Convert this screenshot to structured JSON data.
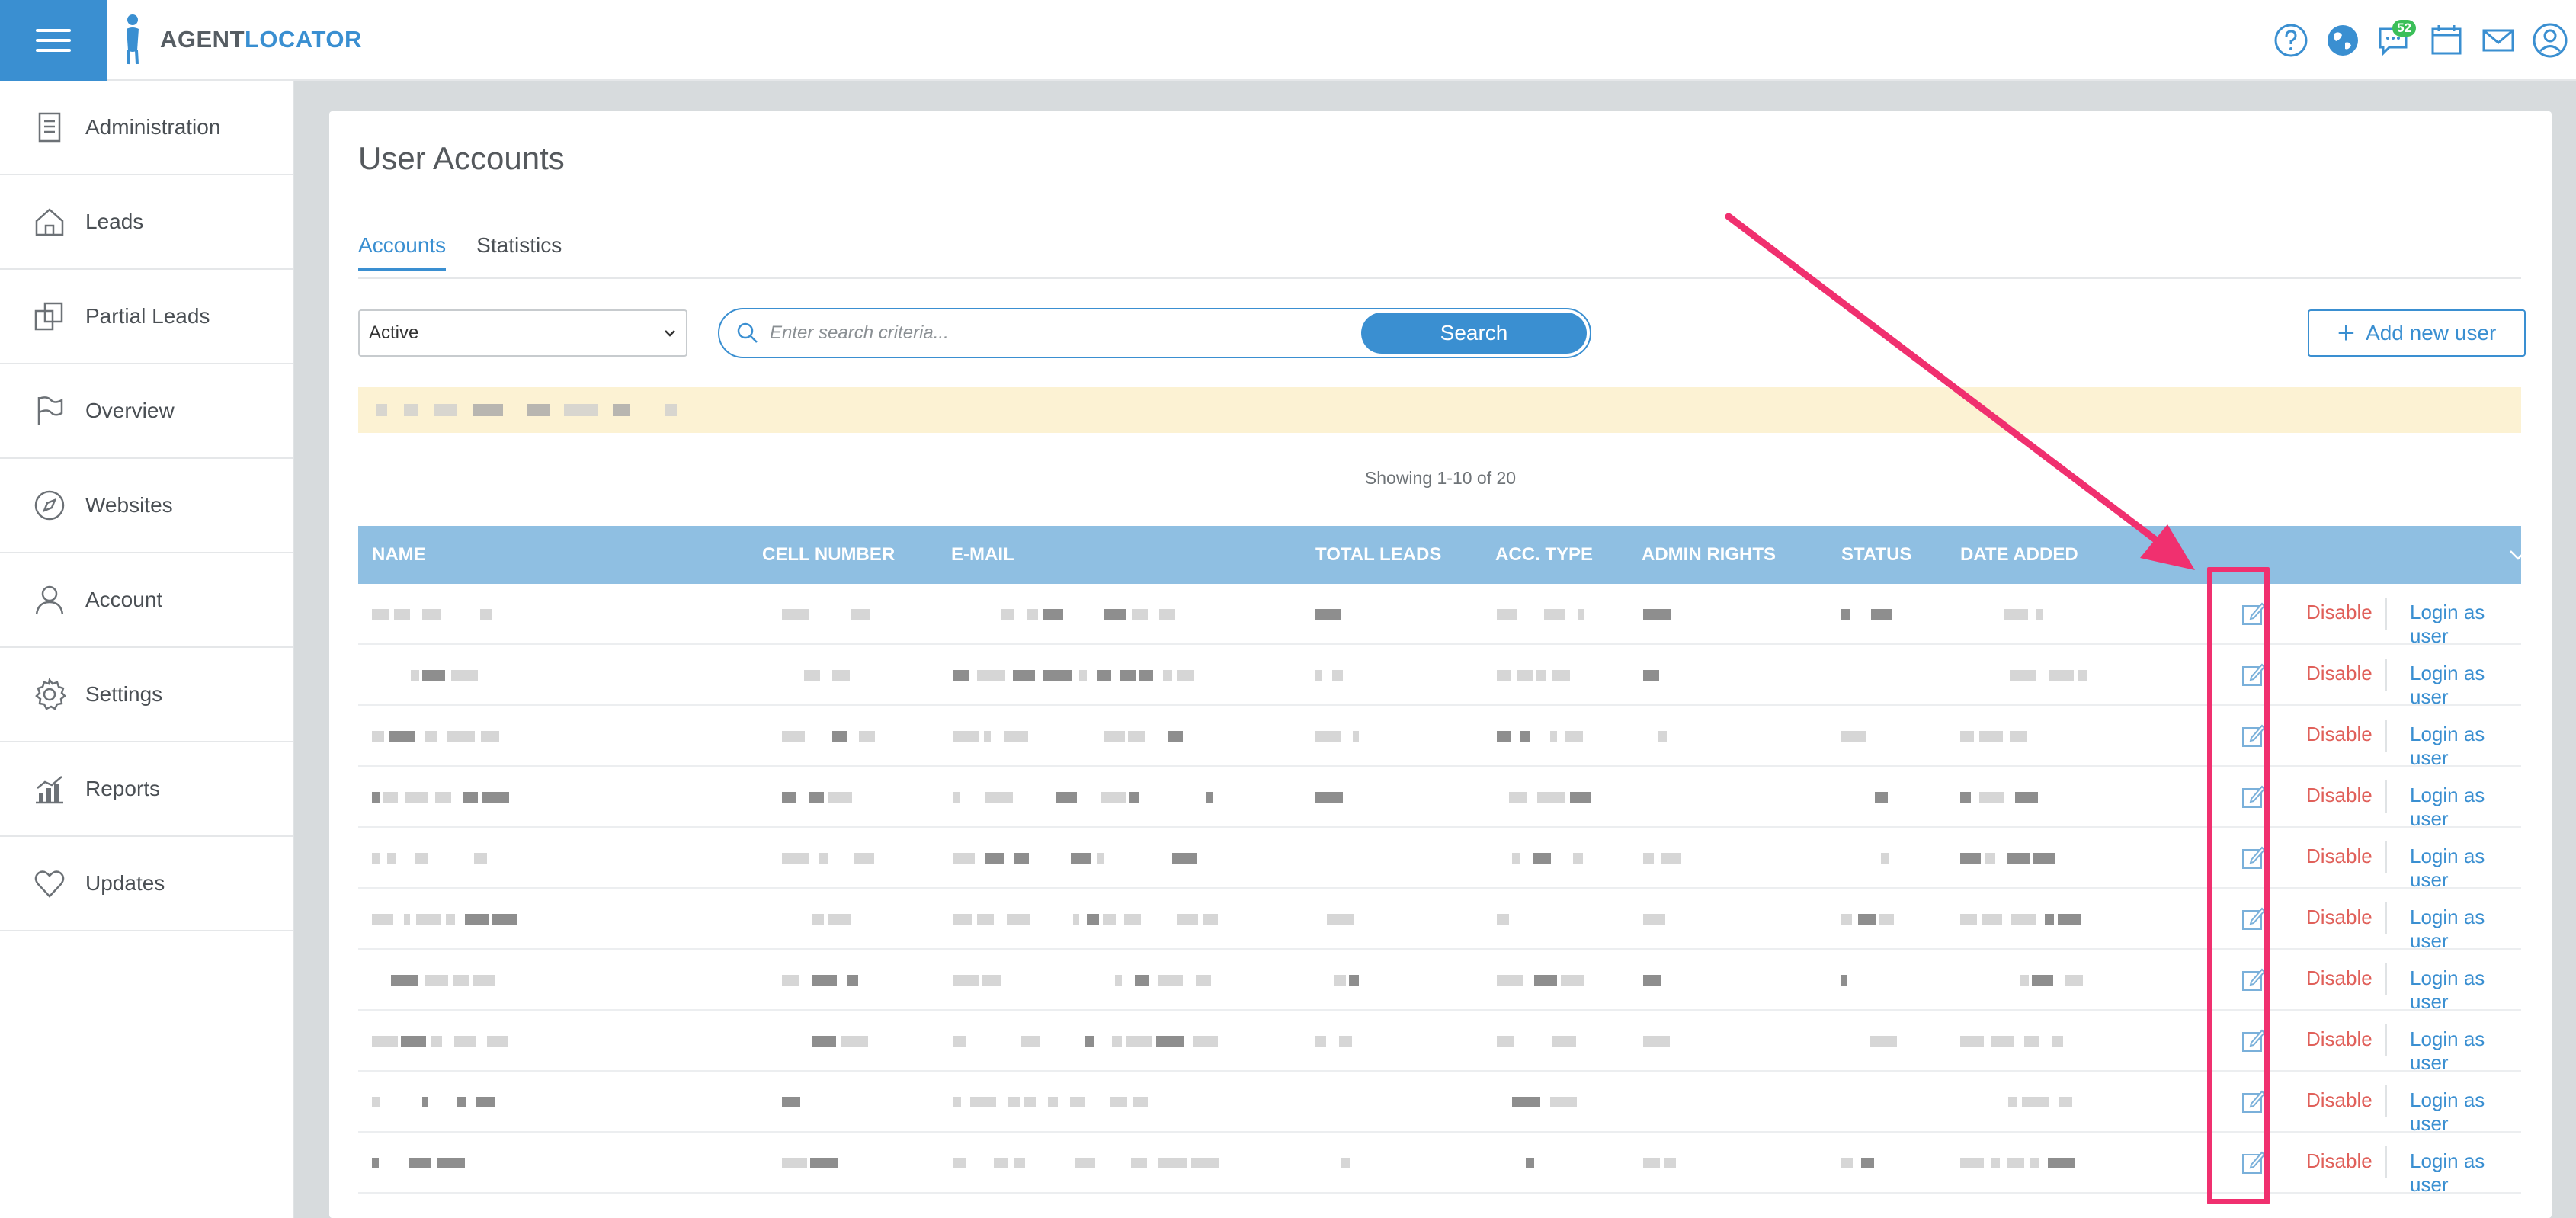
{
  "header": {
    "logo_part1": "AGENT",
    "logo_part2": "LOCATOR",
    "messages_badge": "52",
    "icons": [
      "help-icon",
      "globe-icon",
      "chat-icon",
      "calendar-icon",
      "mail-icon",
      "user-icon"
    ]
  },
  "sidebar": {
    "items": [
      {
        "label": "Administration",
        "icon": "document-icon"
      },
      {
        "label": "Leads",
        "icon": "home-icon"
      },
      {
        "label": "Partial Leads",
        "icon": "copy-icon"
      },
      {
        "label": "Overview",
        "icon": "flag-icon"
      },
      {
        "label": "Websites",
        "icon": "compass-icon"
      },
      {
        "label": "Account",
        "icon": "person-icon"
      },
      {
        "label": "Settings",
        "icon": "gear-icon"
      },
      {
        "label": "Reports",
        "icon": "chart-icon"
      },
      {
        "label": "Updates",
        "icon": "heart-icon"
      }
    ]
  },
  "main": {
    "title": "User Accounts",
    "tabs": [
      {
        "label": "Accounts",
        "active": true
      },
      {
        "label": "Statistics",
        "active": false
      }
    ],
    "status_filter": {
      "selected": "Active"
    },
    "search": {
      "placeholder": "Enter search criteria...",
      "button_label": "Search"
    },
    "add_user_label": "Add new user",
    "showing_text": "Showing 1-10 of 20"
  },
  "table": {
    "columns": [
      "NAME",
      "CELL NUMBER",
      "E-MAIL",
      "TOTAL LEADS",
      "ACC. TYPE",
      "ADMIN RIGHTS",
      "STATUS",
      "DATE ADDED"
    ],
    "rows": [
      {
        "disable": "Disable",
        "login": "Login as user"
      },
      {
        "disable": "Disable",
        "login": "Login as user"
      },
      {
        "disable": "Disable",
        "login": "Login as user"
      },
      {
        "disable": "Disable",
        "login": "Login as user"
      },
      {
        "disable": "Disable",
        "login": "Login as user"
      },
      {
        "disable": "Disable",
        "login": "Login as user"
      },
      {
        "disable": "Disable",
        "login": "Login as user"
      },
      {
        "disable": "Disable",
        "login": "Login as user"
      },
      {
        "disable": "Disable",
        "login": "Login as user"
      },
      {
        "disable": "Disable",
        "login": "Login as user"
      }
    ]
  },
  "colors": {
    "accent": "#3a8fd1",
    "table_header": "#8fbfe2",
    "disable": "#e0605a",
    "annotation": "#f0306f",
    "notice_bg": "#fcf2d3"
  }
}
